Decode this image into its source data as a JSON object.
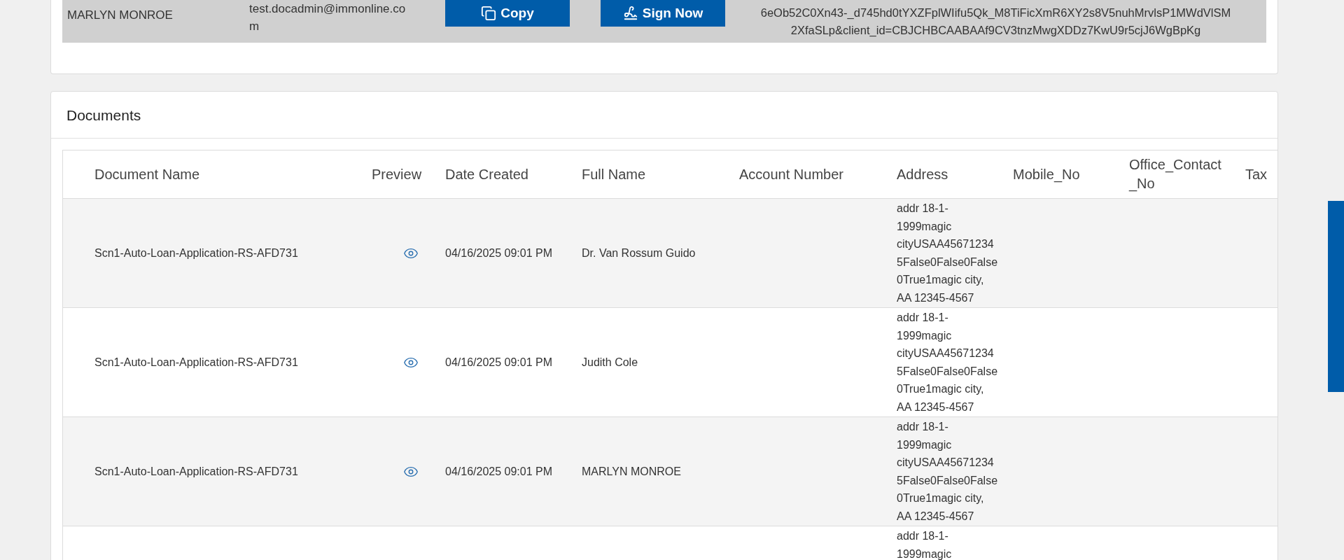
{
  "signer_row": {
    "name": "MARLYN MONROE",
    "email_lines": [
      "test.docadmin@immonline.co",
      "m"
    ],
    "copy_button": "Copy",
    "sign_button": "Sign Now",
    "link_lines": [
      "6eOb52C0Xn43-_d745hd0tYXZFplWIifu5Qk_M8TiFicXmR6XY2s8V5nuhMrvlsP1MWdVlSM",
      "2XfaSLp&client_id=CBJCHBCAABAAf9CV3tnzMwgXDDz7KwU9r5cjJ6WgBpKg"
    ]
  },
  "documents": {
    "title": "Documents",
    "columns": [
      "Document Name",
      "Preview",
      "Date Created",
      "Full Name",
      "Account Number",
      "Address",
      "Mobile_No",
      "Office_Contact_No",
      "Tax"
    ],
    "rows": [
      {
        "document_name": "Scn1-Auto-Loan-Application-RS-AFD731",
        "preview": true,
        "date_created": "04/16/2025 09:01 PM",
        "full_name": "Dr. Van Rossum Guido",
        "address_lines": [
          "addr 18-1-",
          "1999magic",
          "cityUSAA45671234",
          "5False0False0False",
          "0True1magic city,",
          "AA 12345-4567"
        ]
      },
      {
        "document_name": "Scn1-Auto-Loan-Application-RS-AFD731",
        "preview": true,
        "date_created": "04/16/2025 09:01 PM",
        "full_name": "Judith Cole",
        "address_lines": [
          "addr 18-1-",
          "1999magic",
          "cityUSAA45671234",
          "5False0False0False",
          "0True1magic city,",
          "AA 12345-4567"
        ]
      },
      {
        "document_name": "Scn1-Auto-Loan-Application-RS-AFD731",
        "preview": true,
        "date_created": "04/16/2025 09:01 PM",
        "full_name": "MARLYN MONROE",
        "address_lines": [
          "addr 18-1-",
          "1999magic",
          "cityUSAA45671234",
          "5False0False0False",
          "0True1magic city,",
          "AA 12345-4567"
        ]
      },
      {
        "address_lines": [
          "addr 18-1-",
          "1999magic"
        ]
      }
    ]
  }
}
